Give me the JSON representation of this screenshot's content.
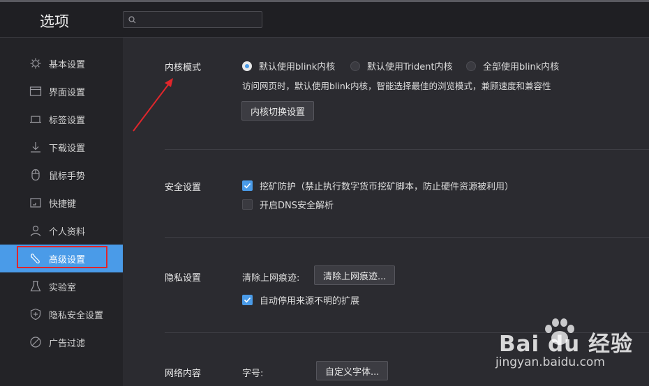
{
  "header": {
    "title": "选项",
    "search": {
      "value": "",
      "placeholder": ""
    }
  },
  "sidebar": {
    "items": [
      {
        "label": "基本设置",
        "icon": "gear-icon"
      },
      {
        "label": "界面设置",
        "icon": "window-icon"
      },
      {
        "label": "标签设置",
        "icon": "tab-icon"
      },
      {
        "label": "下载设置",
        "icon": "download-icon"
      },
      {
        "label": "鼠标手势",
        "icon": "mouse-icon"
      },
      {
        "label": "快捷键",
        "icon": "keyboard-icon"
      },
      {
        "label": "个人资料",
        "icon": "user-icon"
      },
      {
        "label": "高级设置",
        "icon": "wrench-icon",
        "active": true
      },
      {
        "label": "实验室",
        "icon": "flask-icon"
      },
      {
        "label": "隐私安全设置",
        "icon": "shield-icon"
      },
      {
        "label": "广告过滤",
        "icon": "block-icon"
      }
    ]
  },
  "kernel": {
    "title": "内核模式",
    "options": [
      "默认使用blink内核",
      "默认使用Trident内核",
      "全部使用blink内核"
    ],
    "selected": 0,
    "description": "访问网页时，默认使用blink内核，智能选择最佳的浏览模式，兼顾速度和兼容性",
    "button": "内核切换设置"
  },
  "security": {
    "title": "安全设置",
    "mining_protection": {
      "label": "挖矿防护（禁止执行数字货币挖矿脚本，防止硬件资源被利用）",
      "checked": true
    },
    "dns": {
      "label": "开启DNS安全解析",
      "checked": false
    }
  },
  "privacy": {
    "title": "隐私设置",
    "clear_label": "清除上网痕迹:",
    "clear_button": "清除上网痕迹...",
    "disable_ext": {
      "label": "自动停用来源不明的扩展",
      "checked": true
    }
  },
  "network": {
    "title": "网络内容",
    "font_label": "字号:",
    "font_button": "自定义字体..."
  },
  "watermark": {
    "brand": "Bai du 经验",
    "url": "jingyan.baidu.com"
  },
  "colors": {
    "accent": "#4a9be8",
    "highlight": "#e0262b",
    "background": "#2b2b30",
    "sidebar": "#232327"
  }
}
